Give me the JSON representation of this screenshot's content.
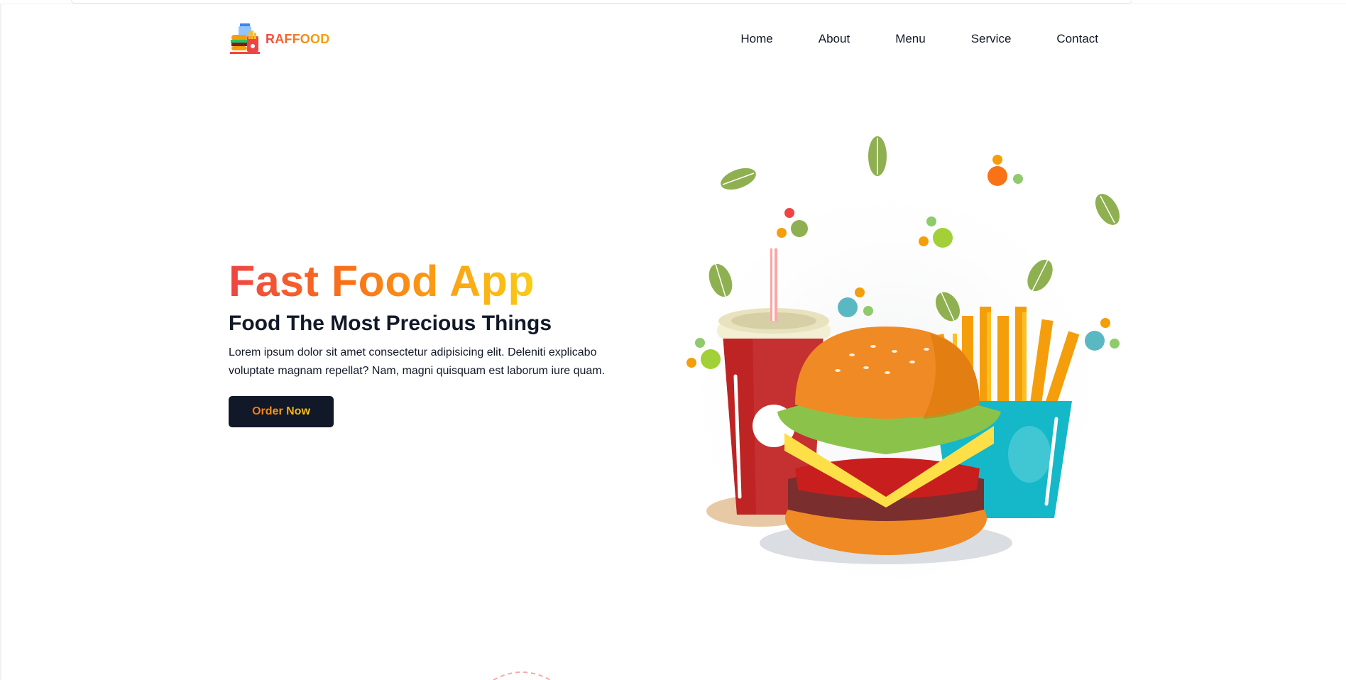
{
  "brand": {
    "name": "RAFFOOD",
    "logo_icon": "fast-food-logo-icon"
  },
  "nav": {
    "items": [
      {
        "label": "Home"
      },
      {
        "label": "About"
      },
      {
        "label": "Menu"
      },
      {
        "label": "Service"
      },
      {
        "label": "Contact"
      }
    ]
  },
  "hero": {
    "title": "Fast Food App",
    "subtitle": "Food The Most Precious Things",
    "description": "Lorem ipsum dolor sit amet consectetur adipisicing elit. Deleniti explicabo voluptate magnam repellat? Nam, magni quisquam est laborum iure quam.",
    "button_label": "Order Now",
    "illustration": "burger-fries-drink-illustration"
  },
  "colors": {
    "accent_red": "#ef4444",
    "accent_orange": "#f97316",
    "accent_yellow": "#facc15",
    "dark": "#111827"
  }
}
